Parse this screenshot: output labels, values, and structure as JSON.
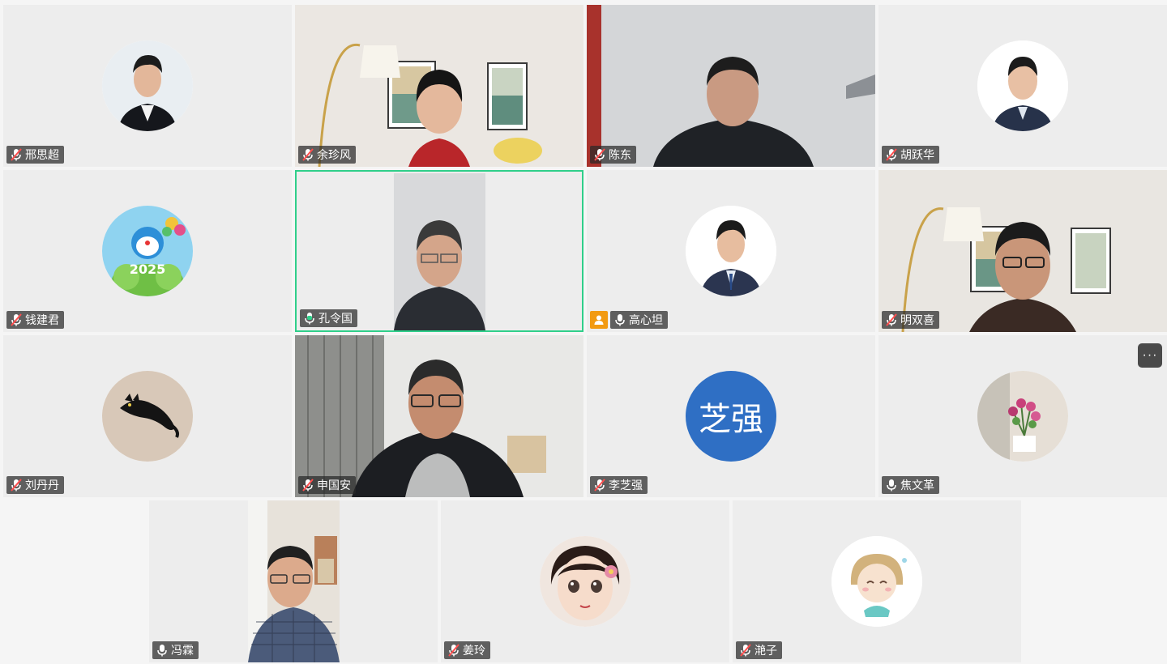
{
  "participants": [
    {
      "name": "邢思超",
      "mic": "muted"
    },
    {
      "name": "余珍风",
      "mic": "muted"
    },
    {
      "name": "陈东",
      "mic": "muted"
    },
    {
      "name": "胡跃华",
      "mic": "muted"
    },
    {
      "name": "钱建君",
      "mic": "muted"
    },
    {
      "name": "孔令国",
      "mic": "speaking",
      "active": true
    },
    {
      "name": "高心坦",
      "mic": "on",
      "host": true
    },
    {
      "name": "明双喜",
      "mic": "muted"
    },
    {
      "name": "刘丹丹",
      "mic": "muted"
    },
    {
      "name": "申国安",
      "mic": "muted"
    },
    {
      "name": "李芝强",
      "mic": "muted",
      "initials": "芝强"
    },
    {
      "name": "焦文革",
      "mic": "on"
    },
    {
      "name": "冯霖",
      "mic": "on"
    },
    {
      "name": "姜玲",
      "mic": "muted"
    },
    {
      "name": "滟子",
      "mic": "muted"
    }
  ],
  "colors": {
    "active_border": "#2fcf8a",
    "host_badge": "#f29a12",
    "initials_bg": "#2f6fc4"
  },
  "icons": {
    "muted": "mic-off-icon",
    "on": "mic-icon",
    "speaking": "mic-speaking-icon",
    "host": "person-icon",
    "more": "more-icon"
  },
  "more_button": {
    "label": "···"
  }
}
